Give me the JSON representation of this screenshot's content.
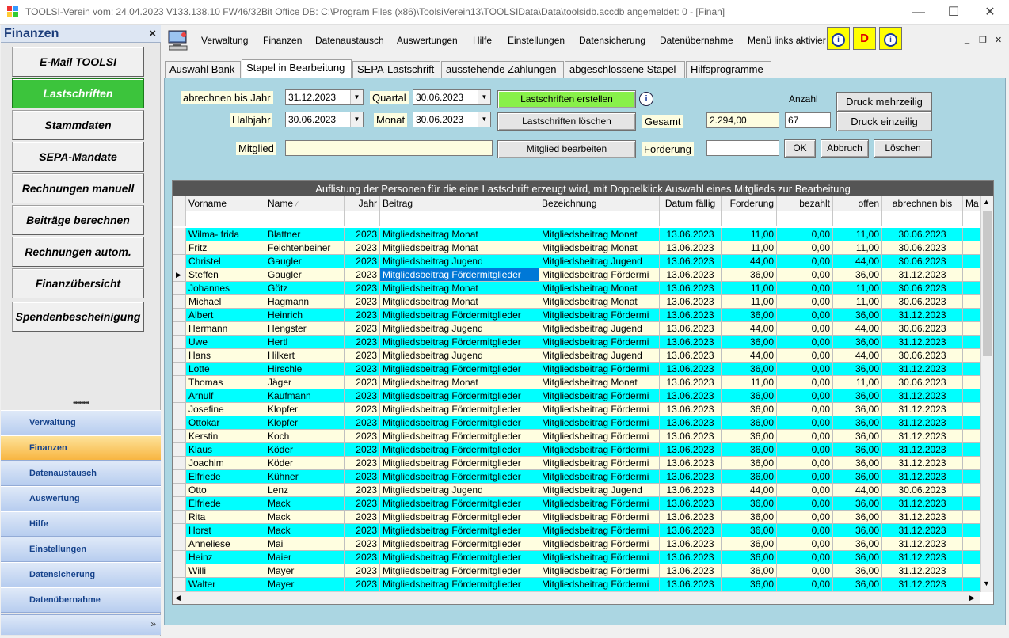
{
  "window": {
    "title": "TOOLSI-Verein  vom: 24.04.2023 V133.138.10 FW46/32Bit Office DB: C:\\Program Files (x86)\\ToolsiVerein13\\TOOLSIData\\Data\\toolsidb.accdb angemeldet: 0  - [Finan]",
    "minimize": "—",
    "maximize": "☐",
    "close": "✕"
  },
  "sidebar": {
    "title": "Finanzen",
    "close": "×",
    "buttons": [
      "E-Mail TOOLSI",
      "Lastschriften",
      "Stammdaten",
      "SEPA-Mandate",
      "Rechnungen manuell",
      "Beiträge berechnen",
      "Rechnungen autom.",
      "Finanzübersicht",
      "Spendenbescheinigung"
    ],
    "active_button": "Lastschriften",
    "splitter": "••••••••",
    "nav": [
      "Verwaltung",
      "Finanzen",
      "Datenaustausch",
      "Auswertung",
      "Hilfe",
      "Einstellungen",
      "Datensicherung",
      "Datenübernahme"
    ],
    "active_nav": "Finanzen",
    "expand": "»"
  },
  "menu": {
    "items": [
      "Verwaltung",
      "Finanzen",
      "Datenaustausch",
      "Auswertungen",
      "Hilfe",
      "Einstellungen",
      "Datensicherung",
      "Datenübernahme",
      "Menü links aktivier"
    ],
    "btn_d": "D",
    "mdi_min": "_",
    "mdi_restore": "❐",
    "mdi_close": "✕"
  },
  "tabs": [
    "Auswahl Bank",
    "Stapel in Bearbeitung",
    "SEPA-Lastschrift",
    "ausstehende Zahlungen",
    "abgeschlossene Stapel",
    "Hilfsprogramme"
  ],
  "active_tab": "Stapel in Bearbeitung",
  "form": {
    "abrechnen_label": "abrechnen bis Jahr",
    "abrechnen_value": "31.12.2023",
    "quartal_label": "Quartal",
    "quartal_value": "30.06.2023",
    "halbjahr_label": "Halbjahr",
    "halbjahr_value": "30.06.2023",
    "monat_label": "Monat",
    "monat_value": "30.06.2023",
    "mitglied_label": "Mitglied",
    "mitglied_value": "",
    "btn_erstellen": "Lastschriften erstellen",
    "btn_loeschen": "Lastschriften löschen",
    "btn_mitglied": "Mitglied bearbeiten",
    "gesamt_label": "Gesamt",
    "gesamt_value": "2.294,00",
    "anzahl_label": "Anzahl",
    "anzahl_value": "67",
    "forderung_label": "Forderung",
    "forderung_value": "",
    "btn_ok": "OK",
    "btn_abbruch": "Abbruch",
    "btn_loeschen2": "Löschen",
    "btn_druck_mehr": "Druck mehrzeilig",
    "btn_druck_ein": "Druck einzeilig",
    "info": "i"
  },
  "grid": {
    "caption": "Auflistung der Personen für die eine Lastschrift erzeugt wird, mit Doppelklick Auswahl eines Mitglieds zur Bearbeitung",
    "columns": [
      "Vorname",
      "Name",
      "Jahr",
      "Beitrag",
      "Bezeichnung",
      "Datum fällig",
      "Forderung",
      "bezahlt",
      "offen",
      "abrechnen bis",
      "Ma"
    ],
    "sort_indicator": "⁄",
    "current_row_marker": "▶",
    "scroll_up": "▲",
    "scroll_down": "▼",
    "scroll_left": "◀",
    "scroll_right": "▶",
    "rows": [
      [
        "Wilma-  frida",
        "Blattner",
        "2023",
        "Mitgliedsbeitrag Monat",
        "Mitgliedsbeitrag Monat",
        "13.06.2023",
        "11,00",
        "0,00",
        "11,00",
        "30.06.2023"
      ],
      [
        "Fritz",
        "Feichtenbeiner",
        "2023",
        "Mitgliedsbeitrag Monat",
        "Mitgliedsbeitrag Monat",
        "13.06.2023",
        "11,00",
        "0,00",
        "11,00",
        "30.06.2023"
      ],
      [
        "Christel",
        "Gaugler",
        "2023",
        "Mitgliedsbeitrag Jugend",
        "Mitgliedsbeitrag Jugend",
        "13.06.2023",
        "44,00",
        "0,00",
        "44,00",
        "30.06.2023"
      ],
      [
        "Steffen",
        "Gaugler",
        "2023",
        "Mitgliedsbeitrag Fördermitglieder",
        "Mitgliedsbeitrag Fördermi",
        "13.06.2023",
        "36,00",
        "0,00",
        "36,00",
        "31.12.2023"
      ],
      [
        "Johannes",
        "Götz",
        "2023",
        "Mitgliedsbeitrag Monat",
        "Mitgliedsbeitrag Monat",
        "13.06.2023",
        "11,00",
        "0,00",
        "11,00",
        "30.06.2023"
      ],
      [
        "Michael",
        "Hagmann",
        "2023",
        "Mitgliedsbeitrag Monat",
        "Mitgliedsbeitrag Monat",
        "13.06.2023",
        "11,00",
        "0,00",
        "11,00",
        "30.06.2023"
      ],
      [
        "Albert",
        "Heinrich",
        "2023",
        "Mitgliedsbeitrag Fördermitglieder",
        "Mitgliedsbeitrag Fördermi",
        "13.06.2023",
        "36,00",
        "0,00",
        "36,00",
        "31.12.2023"
      ],
      [
        "Hermann",
        "Hengster",
        "2023",
        "Mitgliedsbeitrag Jugend",
        "Mitgliedsbeitrag Jugend",
        "13.06.2023",
        "44,00",
        "0,00",
        "44,00",
        "30.06.2023"
      ],
      [
        "Uwe",
        "Hertl",
        "2023",
        "Mitgliedsbeitrag Fördermitglieder",
        "Mitgliedsbeitrag Fördermi",
        "13.06.2023",
        "36,00",
        "0,00",
        "36,00",
        "31.12.2023"
      ],
      [
        "Hans",
        "Hilkert",
        "2023",
        "Mitgliedsbeitrag Jugend",
        "Mitgliedsbeitrag Jugend",
        "13.06.2023",
        "44,00",
        "0,00",
        "44,00",
        "30.06.2023"
      ],
      [
        "Lotte",
        "Hirschle",
        "2023",
        "Mitgliedsbeitrag Fördermitglieder",
        "Mitgliedsbeitrag Fördermi",
        "13.06.2023",
        "36,00",
        "0,00",
        "36,00",
        "31.12.2023"
      ],
      [
        "Thomas",
        "Jäger",
        "2023",
        "Mitgliedsbeitrag Monat",
        "Mitgliedsbeitrag Monat",
        "13.06.2023",
        "11,00",
        "0,00",
        "11,00",
        "30.06.2023"
      ],
      [
        "Arnulf",
        "Kaufmann",
        "2023",
        "Mitgliedsbeitrag Fördermitglieder",
        "Mitgliedsbeitrag Fördermi",
        "13.06.2023",
        "36,00",
        "0,00",
        "36,00",
        "31.12.2023"
      ],
      [
        "Josefine",
        "Klopfer",
        "2023",
        "Mitgliedsbeitrag Fördermitglieder",
        "Mitgliedsbeitrag Fördermi",
        "13.06.2023",
        "36,00",
        "0,00",
        "36,00",
        "31.12.2023"
      ],
      [
        "Ottokar",
        "Klopfer",
        "2023",
        "Mitgliedsbeitrag Fördermitglieder",
        "Mitgliedsbeitrag Fördermi",
        "13.06.2023",
        "36,00",
        "0,00",
        "36,00",
        "31.12.2023"
      ],
      [
        "Kerstin",
        "Koch",
        "2023",
        "Mitgliedsbeitrag Fördermitglieder",
        "Mitgliedsbeitrag Fördermi",
        "13.06.2023",
        "36,00",
        "0,00",
        "36,00",
        "31.12.2023"
      ],
      [
        "Klaus",
        "Köder",
        "2023",
        "Mitgliedsbeitrag Fördermitglieder",
        "Mitgliedsbeitrag Fördermi",
        "13.06.2023",
        "36,00",
        "0,00",
        "36,00",
        "31.12.2023"
      ],
      [
        "Joachim",
        "Köder",
        "2023",
        "Mitgliedsbeitrag Fördermitglieder",
        "Mitgliedsbeitrag Fördermi",
        "13.06.2023",
        "36,00",
        "0,00",
        "36,00",
        "31.12.2023"
      ],
      [
        "Elfriede",
        "Kühner",
        "2023",
        "Mitgliedsbeitrag Fördermitglieder",
        "Mitgliedsbeitrag Fördermi",
        "13.06.2023",
        "36,00",
        "0,00",
        "36,00",
        "31.12.2023"
      ],
      [
        "Otto",
        "Lenz",
        "2023",
        "Mitgliedsbeitrag Jugend",
        "Mitgliedsbeitrag Jugend",
        "13.06.2023",
        "44,00",
        "0,00",
        "44,00",
        "30.06.2023"
      ],
      [
        "Elfriede",
        "Mack",
        "2023",
        "Mitgliedsbeitrag Fördermitglieder",
        "Mitgliedsbeitrag Fördermi",
        "13.06.2023",
        "36,00",
        "0,00",
        "36,00",
        "31.12.2023"
      ],
      [
        "Rita",
        "Mack",
        "2023",
        "Mitgliedsbeitrag Fördermitglieder",
        "Mitgliedsbeitrag Fördermi",
        "13.06.2023",
        "36,00",
        "0,00",
        "36,00",
        "31.12.2023"
      ],
      [
        "Horst",
        "Mack",
        "2023",
        "Mitgliedsbeitrag Fördermitglieder",
        "Mitgliedsbeitrag Fördermi",
        "13.06.2023",
        "36,00",
        "0,00",
        "36,00",
        "31.12.2023"
      ],
      [
        "Anneliese",
        "Mai",
        "2023",
        "Mitgliedsbeitrag Fördermitglieder",
        "Mitgliedsbeitrag Fördermi",
        "13.06.2023",
        "36,00",
        "0,00",
        "36,00",
        "31.12.2023"
      ],
      [
        "Heinz",
        "Maier",
        "2023",
        "Mitgliedsbeitrag Fördermitglieder",
        "Mitgliedsbeitrag Fördermi",
        "13.06.2023",
        "36,00",
        "0,00",
        "36,00",
        "31.12.2023"
      ],
      [
        "Willi",
        "Mayer",
        "2023",
        "Mitgliedsbeitrag Fördermitglieder",
        "Mitgliedsbeitrag Fördermi",
        "13.06.2023",
        "36,00",
        "0,00",
        "36,00",
        "31.12.2023"
      ],
      [
        "Walter",
        "Mayer",
        "2023",
        "Mitgliedsbeitrag Fördermitglieder",
        "Mitgliedsbeitrag Fördermi",
        "13.06.2023",
        "36,00",
        "0,00",
        "36,00",
        "31.12.2023"
      ]
    ],
    "selected_row": 3,
    "selected_col": 3
  },
  "colors": {
    "row_a": "#00ffff",
    "row_b": "#fffee0",
    "panel": "#abd6e2",
    "active_green": "#3cc43c",
    "selection": "#0078d7"
  }
}
